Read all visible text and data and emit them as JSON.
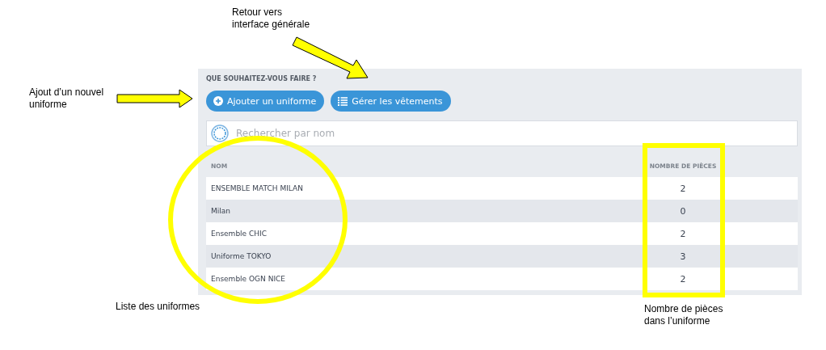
{
  "heading": "QUE SOUHAITEZ-VOUS FAIRE ?",
  "actions": [
    {
      "kind": "add",
      "label": "Ajouter un uniforme"
    },
    {
      "kind": "list",
      "label": "Gérer les vêtements"
    }
  ],
  "search": {
    "placeholder": "Rechercher par nom"
  },
  "table": {
    "columns": [
      "NOM",
      "NOMBRE DE PIÈCES"
    ],
    "rows": [
      [
        "ENSEMBLE MATCH MILAN",
        "2"
      ],
      [
        "Milan",
        "0"
      ],
      [
        "Ensemble CHIC",
        "2"
      ],
      [
        "Uniforme TOKYO",
        "3"
      ],
      [
        "Ensemble OGN NICE",
        "2"
      ]
    ]
  },
  "annotations": [
    {
      "text": "Retour vers interface générale"
    },
    {
      "text": "Ajout d’un nouvel uniforme"
    },
    {
      "text": "Liste des uniformes"
    },
    {
      "text": "Nombre de pièces dans l’uniforme"
    }
  ]
}
